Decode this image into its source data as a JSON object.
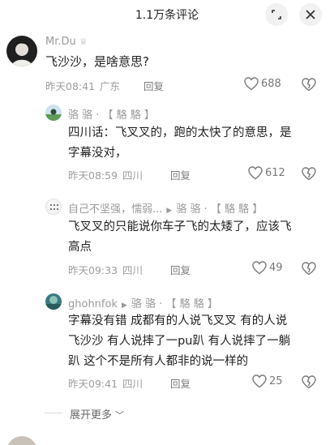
{
  "header": {
    "title": "1.1万条评论",
    "collapse_icon": "collapse-icon",
    "close_icon": "close-icon"
  },
  "comments": [
    {
      "user": "Mr.Du",
      "badge_icon": "crown-icon",
      "text": "飞沙沙，是啥意思?",
      "time": "昨天08:41",
      "location": "广东",
      "reply_label": "回复",
      "likes": "688"
    }
  ],
  "replies": [
    {
      "user": "骆 骆 · 【 駱 駱 】",
      "text_lines": [
        "四川话：飞叉叉的，跑的太快了的意思，是",
        "字幕没对，"
      ],
      "time": "昨天08:59",
      "location": "四川",
      "reply_label": "回复",
      "likes": "612"
    },
    {
      "user": "自己不坚强，懦弱...",
      "reply_to": "骆 骆 · 【 駱 駱 】",
      "text_lines": [
        "飞叉叉的只能说你车子飞的太矮了，应该飞",
        "高点"
      ],
      "time": "昨天09:33",
      "location": "四川",
      "reply_label": "回复",
      "likes": "49"
    },
    {
      "user": "ghohnfok",
      "reply_to": "骆 骆 · 【 駱 駱 】",
      "text_lines": [
        "字幕没有错 成都有的人说飞叉叉 有的人说",
        "飞沙沙 有人说摔了一pu趴 有人说摔了一躺",
        "趴 这个不是所有人都非的说一样的"
      ],
      "time": "昨天09:41",
      "location": "四川",
      "reply_label": "回复",
      "likes": "25"
    }
  ],
  "expand_more": "展开更多",
  "colors": {
    "muted": "#9d9d9d",
    "text": "#1f1f1f",
    "button_bg": "#f1f1f1"
  }
}
